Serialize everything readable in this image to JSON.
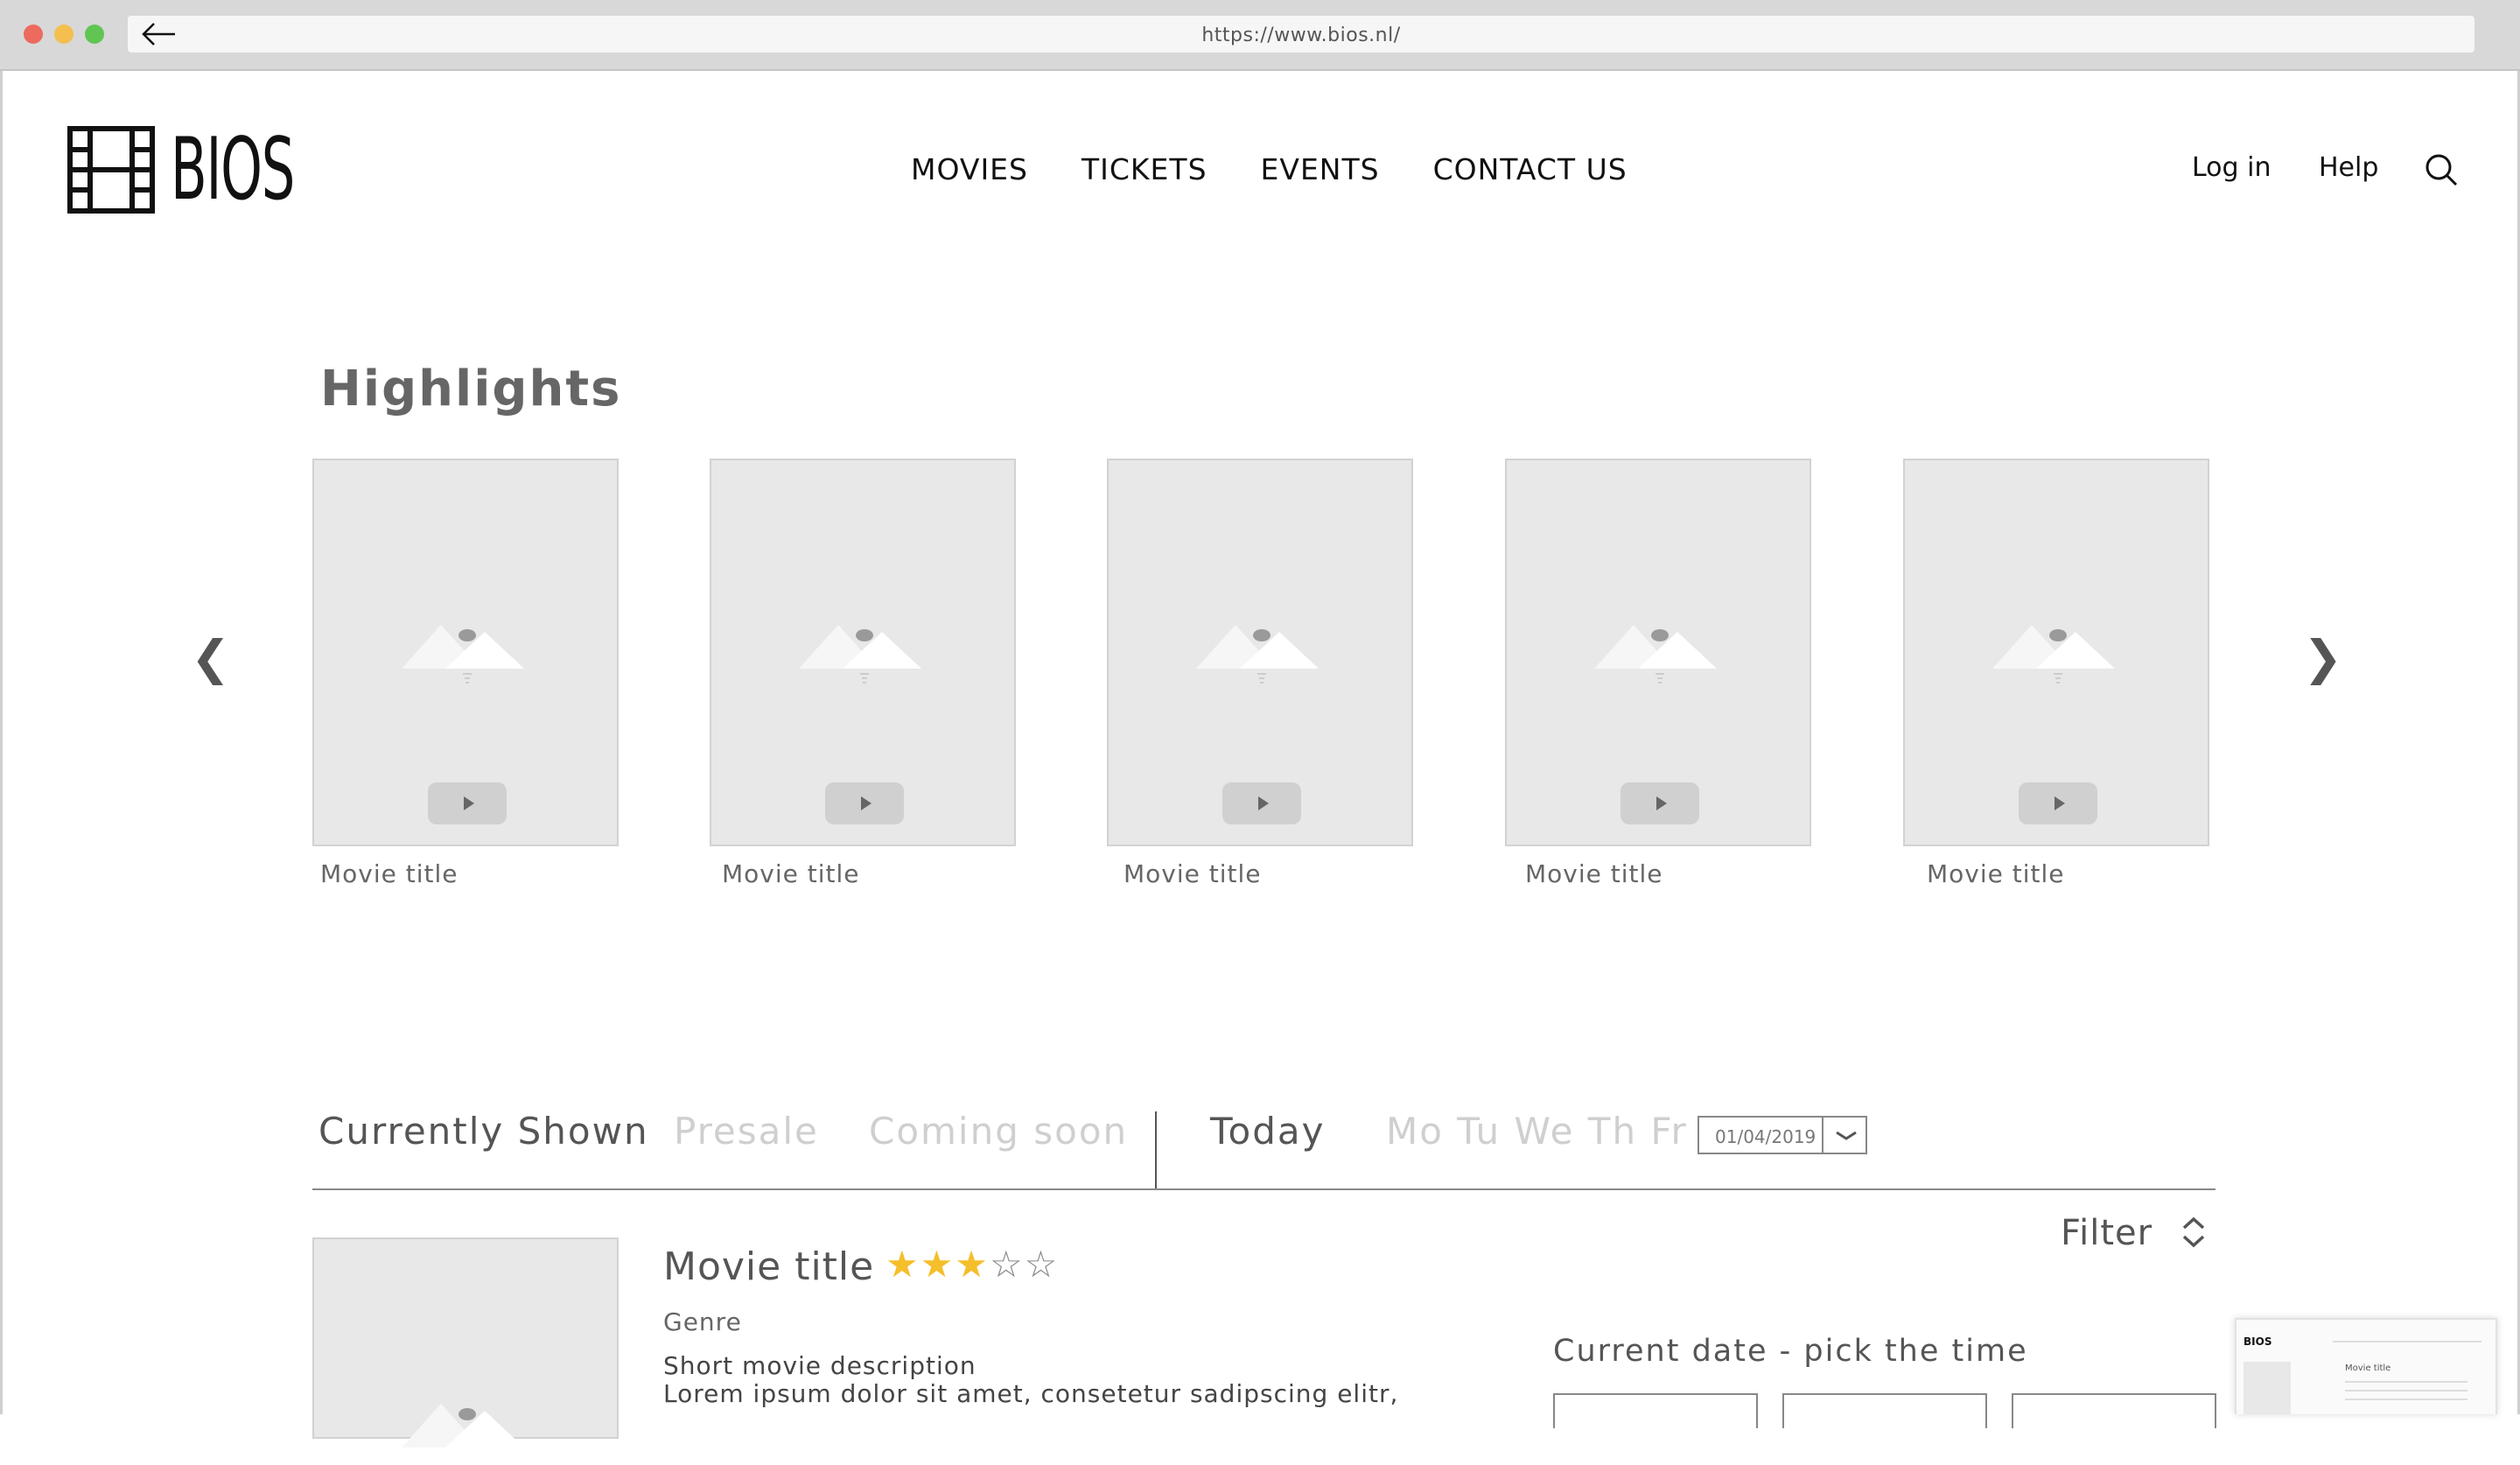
{
  "browser": {
    "url": "https://www.bios.nl/"
  },
  "header": {
    "logo_text": "BIOS",
    "nav": [
      "MOVIES",
      "TICKETS",
      "EVENTS",
      "CONTACT US"
    ],
    "login": "Log in",
    "help": "Help"
  },
  "highlights": {
    "title": "Highlights",
    "prev_arrow": "❮",
    "next_arrow": "❯",
    "movies": [
      {
        "title": "Movie title"
      },
      {
        "title": "Movie title"
      },
      {
        "title": "Movie title"
      },
      {
        "title": "Movie title"
      },
      {
        "title": "Movie title"
      }
    ]
  },
  "listing": {
    "tabs": [
      "Currently Shown",
      "Presale",
      "Coming soon"
    ],
    "day_today": "Today",
    "days": "Mo Tu We Th Fr",
    "date_value": "01/04/2019",
    "filter": "Filter",
    "movie": {
      "title": "Movie title",
      "rating": 3,
      "rating_max": 5,
      "stars_on": "★★★",
      "stars_off": "☆☆",
      "genre": "Genre",
      "description_title": "Short movie description",
      "description": "Lorem ipsum dolor sit amet, consetetur sadipscing elitr,"
    },
    "pick_time": "Current date - pick the time"
  },
  "colors": {
    "star": "#f5be2b",
    "placeholder": "#e8e8e8",
    "muted_text": "#cfcfcf"
  },
  "thumbnail": {
    "logo": "BIOS",
    "title": "Movie title"
  }
}
